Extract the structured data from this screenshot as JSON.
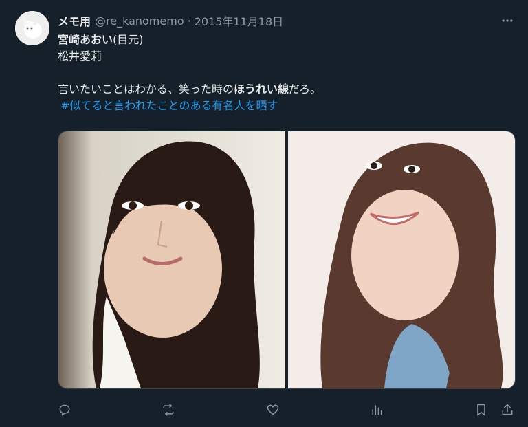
{
  "tweet": {
    "display_name": "メモ用",
    "handle": "@re_kanomemo",
    "separator": "·",
    "date": "2015年11月18日",
    "lines": {
      "line1_bold": "宮崎あおい",
      "line1_rest": "(目元)",
      "line2": "松井愛莉",
      "line3_a": "言いたいことはわかる、笑った時の",
      "line3_bold": "ほうれい線",
      "line3_b": "だろ。",
      "hashtag": "#似てると言われたことのある有名人を晒す"
    }
  },
  "icons": {
    "more": "more-icon",
    "reply": "reply-icon",
    "retweet": "retweet-icon",
    "like": "heart-icon",
    "views": "bar-chart-icon",
    "bookmark": "bookmark-icon",
    "share": "share-icon"
  },
  "colors": {
    "background": "#15202b",
    "text": "#e7e9ea",
    "muted": "#8b98a5",
    "link": "#1d9bf0"
  }
}
